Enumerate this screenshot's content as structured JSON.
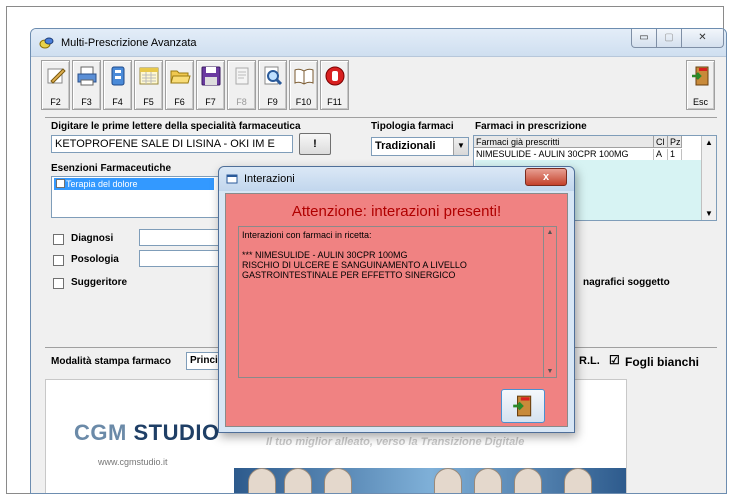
{
  "window": {
    "title": "Multi-Prescrizione Avanzata",
    "minimize": "▭",
    "maximize": "▢",
    "close": "✕"
  },
  "toolbar": {
    "buttons": [
      {
        "key": "F2",
        "icon": "prescription-pen-icon"
      },
      {
        "key": "F3",
        "icon": "printer-icon"
      },
      {
        "key": "F4",
        "icon": "database-icon"
      },
      {
        "key": "F5",
        "icon": "calendar-icon"
      },
      {
        "key": "F6",
        "icon": "folder-open-icon"
      },
      {
        "key": "F7",
        "icon": "save-floppy-icon"
      },
      {
        "key": "F8",
        "icon": "notepad-icon"
      },
      {
        "key": "F9",
        "icon": "search-document-icon"
      },
      {
        "key": "F10",
        "icon": "open-book-icon"
      },
      {
        "key": "F11",
        "icon": "stop-hand-icon"
      },
      {
        "key": "Esc",
        "icon": "exit-door-icon"
      }
    ]
  },
  "search": {
    "label": "Digitare le prime lettere della specialità farmaceutica",
    "value": "KETOPROFENE SALE DI LISINA - OKI IM E",
    "button": "!"
  },
  "tipologia": {
    "label": "Tipologia farmaci",
    "selected": "Tradizionali",
    "arrow": "▼"
  },
  "prescription": {
    "label": "Farmaci in prescrizione",
    "columns": [
      "Farmaci già prescritti",
      "Cl",
      "Pz"
    ],
    "rows": [
      {
        "name": "NIMESULIDE - AULIN 30CPR 100MG",
        "cl": "A",
        "pz": "1"
      }
    ],
    "scroll_up": "▲",
    "scroll_down": "▼"
  },
  "esenzioni": {
    "label": "Esenzioni Farmaceutiche",
    "items": [
      "Terapia del dolore"
    ]
  },
  "options": {
    "diagnosi": "Diagnosi",
    "posologia": "Posologia",
    "suggeritore": "Suggeritore",
    "anagrafici": "nagrafici soggetto"
  },
  "stampa": {
    "label": "Modalità stampa farmaco",
    "value": "Princi",
    "rl": "R.L.",
    "fogli_label": "Fogli bianchi",
    "fogli_checked": "☑"
  },
  "banner": {
    "brand1": "CGM",
    "brand2": "STUDIO",
    "url": "www.cgmstudio.it",
    "tagline": "Il tuo miglior alleato, verso la Transizione Digitale"
  },
  "dialog": {
    "title": "Interazioni",
    "close": "x",
    "heading": "Attenzione: interazioni presenti!",
    "intro": "Interazioni con farmaci in ricetta:",
    "line1": "*** NIMESULIDE - AULIN 30CPR 100MG",
    "line2": "RISCHIO DI ULCERE E SANGUINAMENTO A LIVELLO",
    "line3": "GASTROINTESTINALE PER EFFETTO SINERGICO",
    "scroll_up": "▲",
    "scroll_down": "▼",
    "ok_icon": "exit-door-icon"
  },
  "colors": {
    "dialog_bg": "#f08282",
    "heading": "#b00000",
    "grid_empty": "#d7f3f3",
    "selection": "#3399ff"
  }
}
